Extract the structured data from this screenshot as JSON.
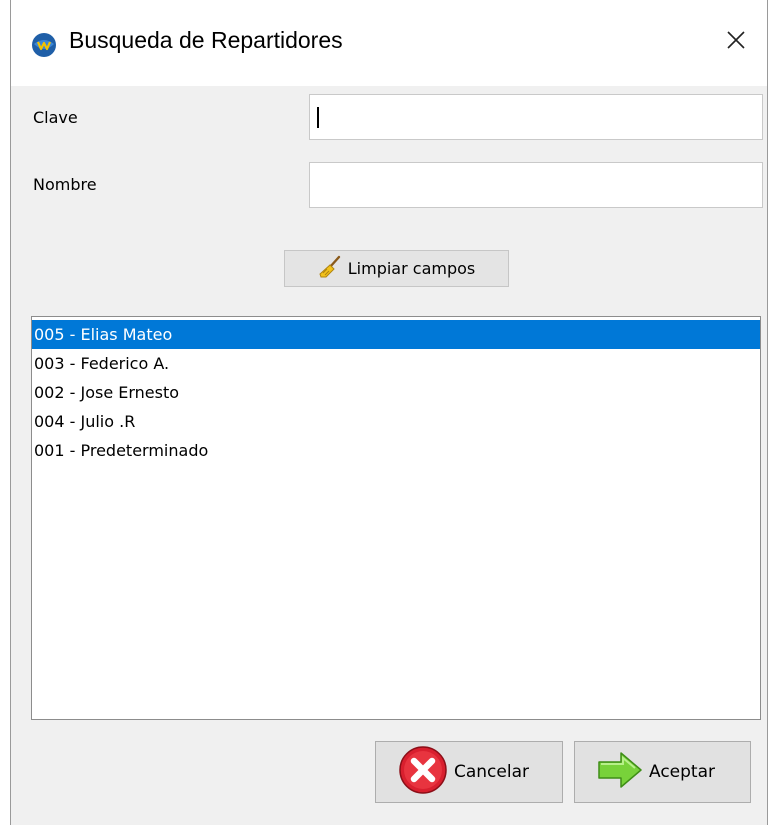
{
  "window": {
    "title": "Busqueda de Repartidores",
    "close_glyph": "✕"
  },
  "form": {
    "clave_label": "Clave",
    "clave_value": "",
    "nombre_label": "Nombre",
    "nombre_value": ""
  },
  "clear_button": {
    "label": "Limpiar campos",
    "icon": "broom-icon"
  },
  "list": {
    "items": [
      {
        "label": "005 - Elias Mateo",
        "selected": true
      },
      {
        "label": "003 - Federico A.",
        "selected": false
      },
      {
        "label": "002 - Jose Ernesto",
        "selected": false
      },
      {
        "label": "004 - Julio .R",
        "selected": false
      },
      {
        "label": "001 - Predeterminado",
        "selected": false
      }
    ],
    "selection_color": "#0078d7"
  },
  "buttons": {
    "cancel_label": "Cancelar",
    "cancel_icon": "red-x-circle-icon",
    "accept_label": "Aceptar",
    "accept_icon": "green-arrow-right-icon"
  }
}
